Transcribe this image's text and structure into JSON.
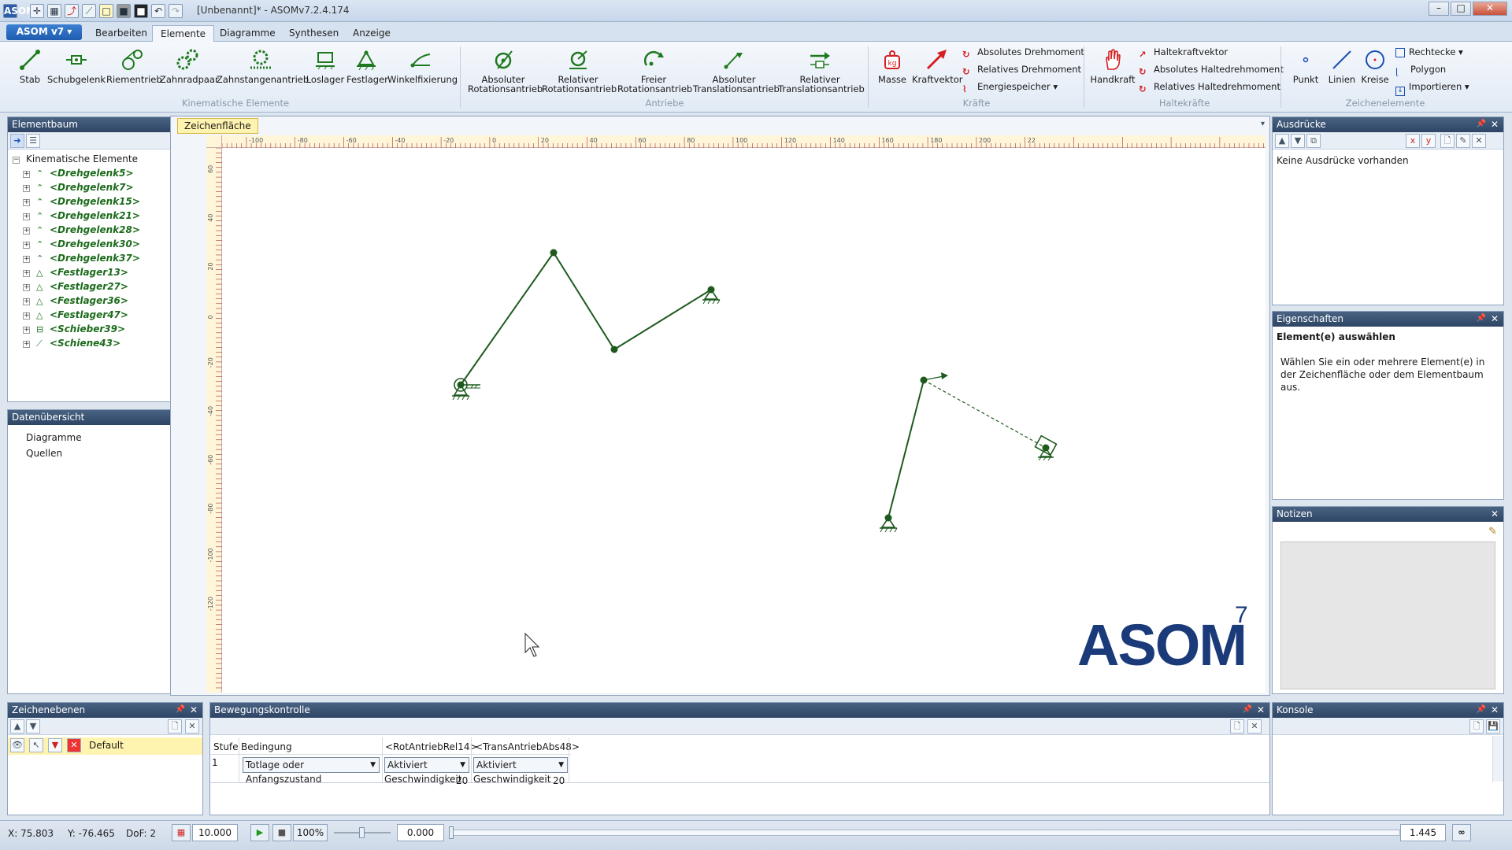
{
  "window": {
    "title": "[Unbenannt]* - ASOMv7.2.4.174",
    "app_icon": "ASOM"
  },
  "menu": {
    "app_button": "ASOM v7 ▾",
    "tabs": [
      "Bearbeiten",
      "Elemente",
      "Diagramme",
      "Synthesen",
      "Anzeige"
    ],
    "active_tab": "Elemente"
  },
  "ribbon": {
    "kinematic": [
      "Stab",
      "Schubgelenk",
      "Riementrieb",
      "Zahnradpaar",
      "Zahnstangenantrieb",
      "Loslager",
      "Festlager",
      "Winkelfixierung"
    ],
    "kinematic_group": "Kinematische Elemente",
    "drives": [
      {
        "l1": "Absoluter",
        "l2": "Rotationsantrieb"
      },
      {
        "l1": "Relativer",
        "l2": "Rotationsantrieb"
      },
      {
        "l1": "Freier",
        "l2": "Rotationsantrieb"
      },
      {
        "l1": "Absoluter",
        "l2": "Translationsantrieb"
      },
      {
        "l1": "Relativer",
        "l2": "Translationsantrieb"
      }
    ],
    "drives_group": "Antriebe",
    "forces_big": [
      "Masse",
      "Kraftvektor"
    ],
    "forces_small": [
      "Absolutes Drehmoment",
      "Relatives Drehmoment",
      "Energiespeicher ▾"
    ],
    "forces_group": "Kräfte",
    "holding_big": "Handkraft",
    "holding_small": [
      "Haltekraftvektor",
      "Absolutes Haltedrehmoment",
      "Relatives Haltedrehmoment"
    ],
    "holding_group": "Haltekräfte",
    "drawing_big": [
      "Punkt",
      "Linien",
      "Kreise"
    ],
    "drawing_small": [
      "Rechtecke ▾",
      "Polygon",
      "Importieren ▾"
    ],
    "drawing_group": "Zeichenelemente"
  },
  "elementbaum": {
    "title": "Elementbaum",
    "root": "Kinematische Elemente",
    "items": [
      {
        "label": "<Drehgelenk5>",
        "icon": "joint-icon"
      },
      {
        "label": "<Drehgelenk7>",
        "icon": "joint-icon"
      },
      {
        "label": "<Drehgelenk15>",
        "icon": "joint-icon"
      },
      {
        "label": "<Drehgelenk21>",
        "icon": "joint-icon"
      },
      {
        "label": "<Drehgelenk28>",
        "icon": "joint-icon"
      },
      {
        "label": "<Drehgelenk30>",
        "icon": "joint-icon"
      },
      {
        "label": "<Drehgelenk37>",
        "icon": "joint-icon"
      },
      {
        "label": "<Festlager13>",
        "icon": "fixed-bearing-icon"
      },
      {
        "label": "<Festlager27>",
        "icon": "fixed-bearing-icon"
      },
      {
        "label": "<Festlager36>",
        "icon": "fixed-bearing-icon"
      },
      {
        "label": "<Festlager47>",
        "icon": "fixed-bearing-icon"
      },
      {
        "label": "<Schieber39>",
        "icon": "slider-icon"
      },
      {
        "label": "<Schiene43>",
        "icon": "rail-icon"
      }
    ]
  },
  "datenuebersicht": {
    "title": "Datenübersicht",
    "items": [
      "Diagramme",
      "Quellen"
    ]
  },
  "zeichenebenen": {
    "title": "Zeichenebenen",
    "layer": "Default"
  },
  "canvas": {
    "tab": "Zeichenfläche",
    "ruler_h": [
      "-100",
      "-80",
      "-60",
      "-40",
      "-20",
      "0",
      "20",
      "40",
      "60",
      "80",
      "100",
      "120",
      "140",
      "160",
      "180",
      "200",
      "22"
    ],
    "ruler_v": [
      "60",
      "40",
      "20",
      "0",
      "-20",
      "-40",
      "-60",
      "-80",
      "-100",
      "-120"
    ],
    "logo": "ASOM",
    "logo_sup": "7"
  },
  "ausdruecke": {
    "title": "Ausdrücke",
    "empty": "Keine Ausdrücke vorhanden"
  },
  "eigenschaften": {
    "title": "Eigenschaften",
    "heading": "Element(e) auswählen",
    "text": "Wählen Sie ein oder mehrere Element(e) in der Zeichenfläche oder dem Elementbaum aus."
  },
  "notizen": {
    "title": "Notizen"
  },
  "bewegungskontrolle": {
    "title": "Bewegungskontrolle",
    "headers": [
      "Stufe",
      "Bedingung",
      "<RotAntriebRel14>",
      "<TransAntriebAbs48>"
    ],
    "row": {
      "stufe": "1",
      "bedingung": "Totlage oder Anfangszustand",
      "rot_state": "Aktiviert",
      "trans_state": "Aktiviert",
      "speed_label": "Geschwindigkeit",
      "rot_speed": "20",
      "trans_speed": "20"
    }
  },
  "konsole": {
    "title": "Konsole"
  },
  "status": {
    "x": "X: 75.803",
    "y": "Y: -76.465",
    "dof": "DoF: 2",
    "grid": "10.000",
    "zoom": "100%",
    "time": "0.000",
    "right_value": "1.445"
  },
  "colors": {
    "mechanism": "#1e5a1e",
    "ribbon_green": "#1f7a1f",
    "force_red": "#d42020",
    "logo_blue": "#1a3a7a",
    "panel_header": "#3a5475"
  }
}
